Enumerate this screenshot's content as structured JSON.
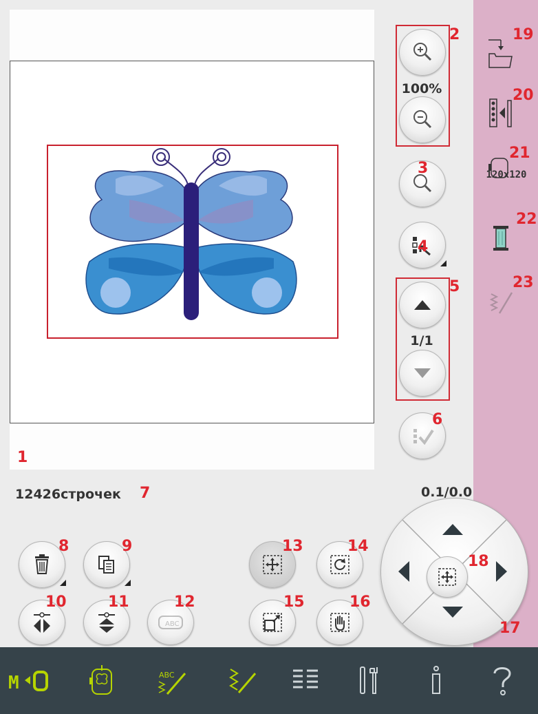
{
  "callouts": {
    "n1": "1",
    "n2": "2",
    "n3": "3",
    "n4": "4",
    "n5": "5",
    "n6": "6",
    "n7": "7",
    "n8": "8",
    "n9": "9",
    "n10": "10",
    "n11": "11",
    "n12": "12",
    "n13": "13",
    "n14": "14",
    "n15": "15",
    "n16": "16",
    "n17": "17",
    "n18": "18",
    "n19": "19",
    "n20": "20",
    "n21": "21",
    "n22": "22",
    "n23": "23"
  },
  "zoom": {
    "level": "100%"
  },
  "pager": {
    "value": "1/1"
  },
  "stitch_count": {
    "text": "12426строчек"
  },
  "position_readout": {
    "text": "0.1/0.0"
  },
  "hoop": {
    "size_label": "120x120"
  },
  "icons": {
    "zoom_in": "zoom-in-icon",
    "zoom_out": "zoom-out-icon",
    "zoom_all": "zoom-icon",
    "select": "select-design-icon",
    "confirm": "checkmark-icon",
    "delete": "trash-icon",
    "duplicate": "duplicate-icon",
    "mirror_horizontal": "mirror-horizontal-icon",
    "mirror_vertical": "mirror-vertical-icon",
    "edit_text": "edit-text-icon",
    "move": "move-icon",
    "rotate": "rotate-icon",
    "scale": "scale-icon",
    "pan": "hand-icon",
    "load": "load-design-icon",
    "stitch_order": "stitch-order-icon",
    "hoop": "hoop-icon",
    "thread": "thread-spool-icon",
    "stitches": "stitches-icon"
  },
  "colors": {
    "accent": "#e0262f",
    "sidebar": "#dcb0c8",
    "bottombar": "#36434a",
    "active": "#b6d400"
  }
}
